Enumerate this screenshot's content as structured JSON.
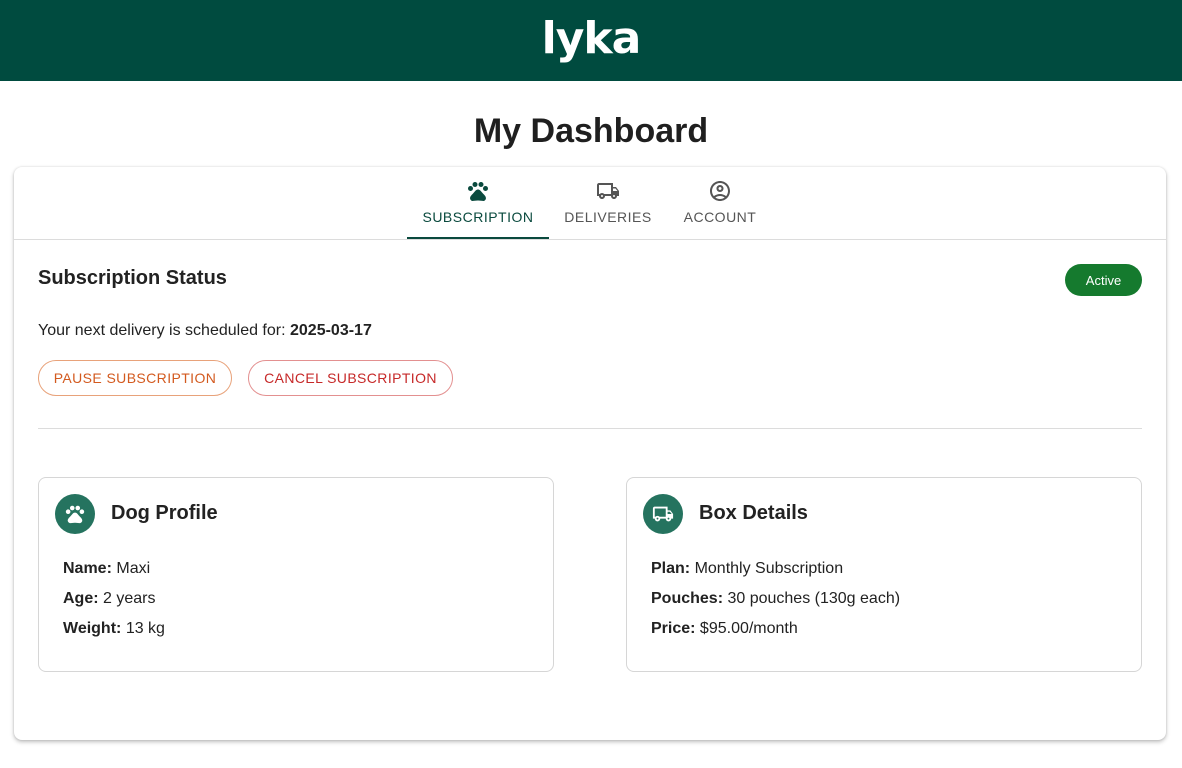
{
  "header": {
    "logo_text": "lyka",
    "bg_color": "#004b3f"
  },
  "page": {
    "title": "My Dashboard"
  },
  "tabs": [
    {
      "label": "SUBSCRIPTION",
      "icon": "paw-icon",
      "active": true
    },
    {
      "label": "DELIVERIES",
      "icon": "truck-icon",
      "active": false
    },
    {
      "label": "ACCOUNT",
      "icon": "account-circle-icon",
      "active": false
    }
  ],
  "subscription": {
    "status_title": "Subscription Status",
    "status_badge": "Active",
    "badge_color": "#157a2e",
    "next_delivery_text": "Your next delivery is scheduled for:",
    "next_delivery_date": "2025-03-17",
    "pause_label": "PAUSE SUBSCRIPTION",
    "cancel_label": "CANCEL SUBSCRIPTION"
  },
  "dog_profile": {
    "title": "Dog Profile",
    "icon": "paw-icon",
    "fields": [
      {
        "label": "Name:",
        "value": "Maxi"
      },
      {
        "label": "Age:",
        "value": "2 years"
      },
      {
        "label": "Weight:",
        "value": "13 kg"
      }
    ]
  },
  "box_details": {
    "title": "Box Details",
    "icon": "truck-icon",
    "fields": [
      {
        "label": "Plan:",
        "value": "Monthly Subscription"
      },
      {
        "label": "Pouches:",
        "value": "30 pouches (130g each)"
      },
      {
        "label": "Price:",
        "value": "$95.00/month"
      }
    ]
  }
}
